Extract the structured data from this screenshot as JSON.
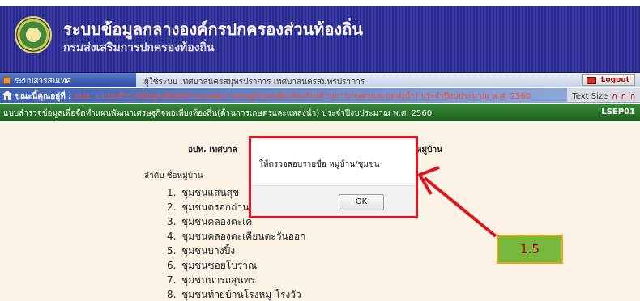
{
  "header": {
    "title": "ระบบข้อมูลกลางองค์กรปกครองส่วนท้องถิ่น",
    "subtitle": "กรมส่งเสริมการปกครองท้องถิ่น"
  },
  "tabbar": {
    "active_tab": "ระบบสารสนเทศ",
    "user_info": "ผู้ใช้ระบบ เทศบาลนครสมุทรปราการ เทศบาลนครสมุทรปราการ",
    "logout_label": "Logout"
  },
  "breadcrumb": {
    "label": "ขณะนี้คุณอยู่ที่ :",
    "path": "อปท. » แบบสำรวจข้อมูลเพื่อจัดทำแผนพัฒนาเศรษฐกิจพอเพียงท้องถิ่น(ด้านการเกษตรและแหล่งน้ำ) ประจำปีงบประมาณ พ.ศ. 2560",
    "text_size_label": "Text Size",
    "text_size_options": [
      "ก",
      "ก",
      "ก"
    ]
  },
  "section": {
    "title": "แบบสำรวจข้อมูลเพื่อจัดทำแผนพัฒนาเศรษฐกิจพอเพียงท้องถิ่น(ด้านการเกษตรและแหล่งน้ำ) ประจำปีงบประมาณ พ.ศ. 2560",
    "code": "LSEP01"
  },
  "content": {
    "org_line": "อปท. เทศบาล",
    "village_count": "31หมู่บ้าน",
    "list_header": "ลำดับ ชื่อหมู่บ้าน",
    "villages": [
      {
        "num": "1.",
        "name": "ชุมชนแสนสุข"
      },
      {
        "num": "2.",
        "name": "ชุมชนตรอกถ่าน"
      },
      {
        "num": "3.",
        "name": "ชุมชนคลองตะเค"
      },
      {
        "num": "4.",
        "name": "ชุมชนคลองตะเคียนตะวันออก"
      },
      {
        "num": "5.",
        "name": "ชุมชนบางปิ้ง"
      },
      {
        "num": "6.",
        "name": "ชุมชนซอยโบราณ"
      },
      {
        "num": "7.",
        "name": "ชุมชนนารถสุนทร"
      },
      {
        "num": "8.",
        "name": "ชุมชนท้ายบ้านโรงหมู-โรงวัว"
      }
    ]
  },
  "dialog": {
    "message": "ให้ตรวจสอบรายชื่อ หมู่บ้าน/ชุมชน",
    "ok_label": "OK"
  },
  "annotation": {
    "label": "1.5"
  },
  "colors": {
    "header_bg": "#2a2a86",
    "section_bg": "#2c7a2c",
    "highlight": "#e0141a",
    "annotation_bg": "#78b83c"
  }
}
